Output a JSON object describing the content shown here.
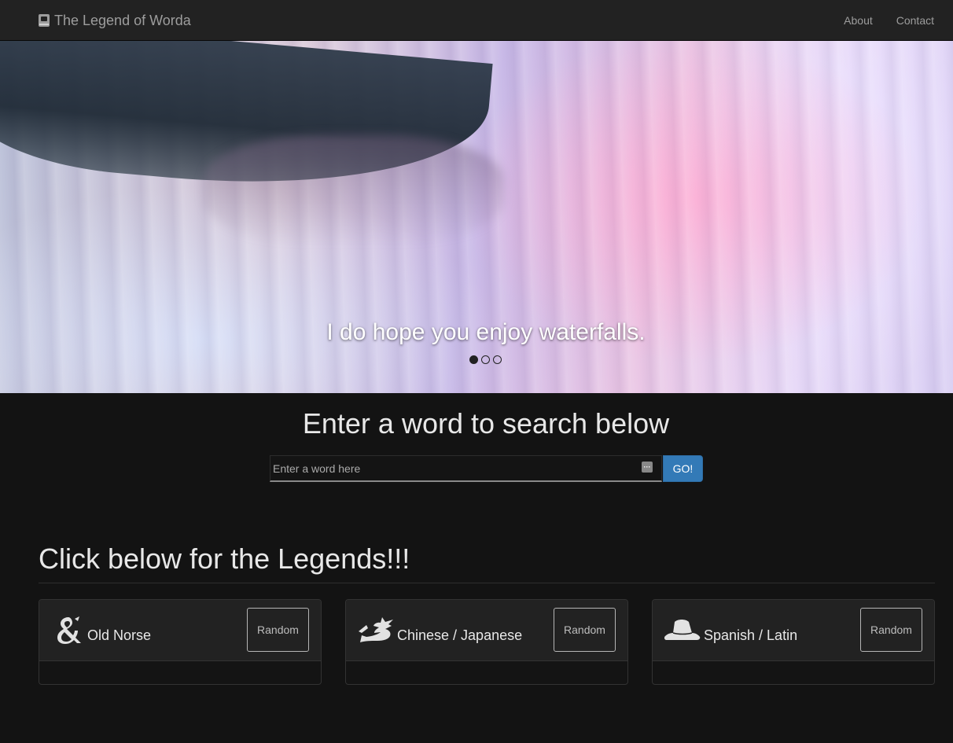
{
  "navbar": {
    "brand": "The Legend of Worda",
    "brand_icon": "book-icon",
    "links": [
      "About",
      "Contact"
    ]
  },
  "carousel": {
    "caption": "I do hope you enjoy waterfalls.",
    "slide_count": 3,
    "active_slide": 1
  },
  "search": {
    "title": "Enter a word to search below",
    "placeholder": "Enter a word here",
    "button": "GO!",
    "button_color": "#337ab7"
  },
  "legends": {
    "title": "Click below for the Legends!!!",
    "cards": [
      {
        "label": "Old Norse",
        "icon": "ampersand-dragon-icon",
        "button": "Random"
      },
      {
        "label": "Chinese / Japanese",
        "icon": "dragon-icon",
        "button": "Random"
      },
      {
        "label": "Spanish / Latin",
        "icon": "sombrero-hat-icon",
        "button": "Random"
      }
    ]
  }
}
